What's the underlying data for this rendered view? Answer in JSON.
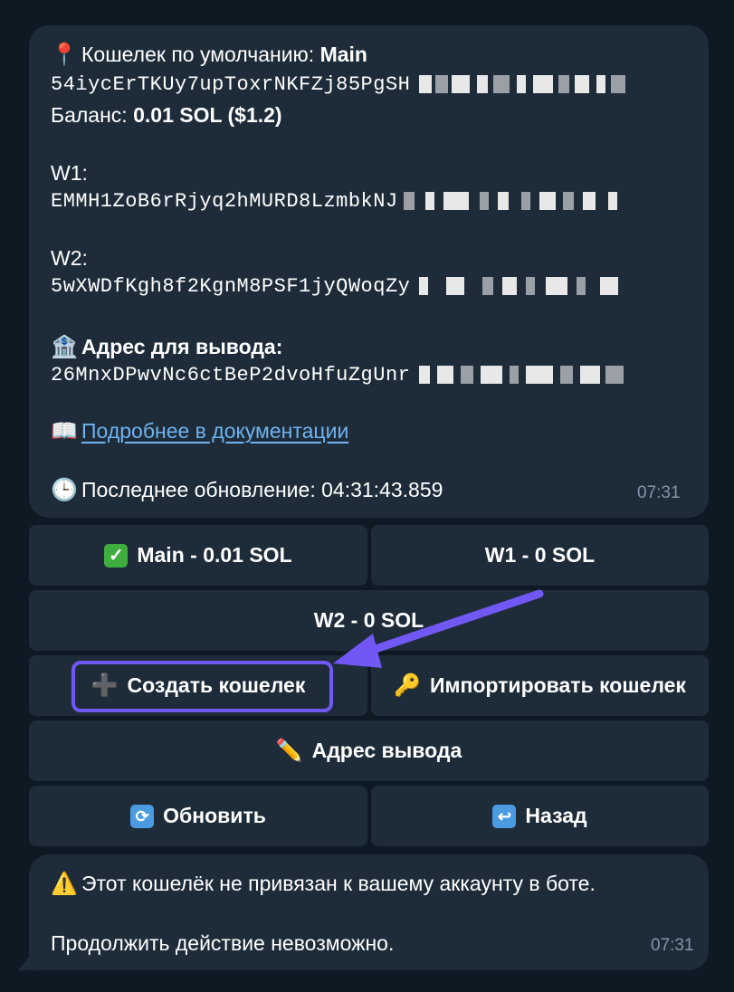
{
  "message": {
    "default_wallet_label": "Кошелек по умолчанию: ",
    "default_wallet_name": "Main",
    "main_address": "54iycErTKUy7upToxrNKFZj85PgSH",
    "balance_label": "Баланс: ",
    "balance_value": "0.01 SOL ($1.2)",
    "w1_label": "W1:",
    "w1_address": "EMMH1ZoB6rRjyq2hMURD8LzmbkNJ",
    "w2_label": "W2:",
    "w2_address": "5wXWDfKgh8f2KgnM8PSF1jyQWoqZy",
    "withdraw_label": "Адрес для вывода:",
    "withdraw_address": "26MnxDPwvNc6ctBeP2dvoHfuZgUnr",
    "docs_link": "Подробнее в документации",
    "last_update": "Последнее обновление: 04:31:43.859",
    "time": "07:31"
  },
  "buttons": {
    "main": "Main - 0.01 SOL",
    "w1": "W1 - 0 SOL",
    "w2": "W2 - 0 SOL",
    "create": "Создать кошелек",
    "import": "Импортировать кошелек",
    "withdraw_address": "Адрес вывода",
    "refresh": "Обновить",
    "back": "Назад"
  },
  "warning": {
    "text": "Этот кошелёк не привязан к вашему аккаунту в боте.",
    "text2": "Продолжить действие невозможно.",
    "time": "07:31"
  },
  "icons": {
    "pin": "pin-icon",
    "bank": "bank-icon",
    "book": "book-icon",
    "clock": "clock-icon",
    "check": "check-icon",
    "plus": "plus-icon",
    "key": "key-icon",
    "pencil": "pencil-icon",
    "refresh": "refresh-icon",
    "back": "back-arrow-icon",
    "warning": "warning-icon"
  },
  "colors": {
    "background": "#0f1923",
    "bubble": "#1e2c3a",
    "link": "#6fb3ef",
    "annotation": "#7158f5"
  }
}
